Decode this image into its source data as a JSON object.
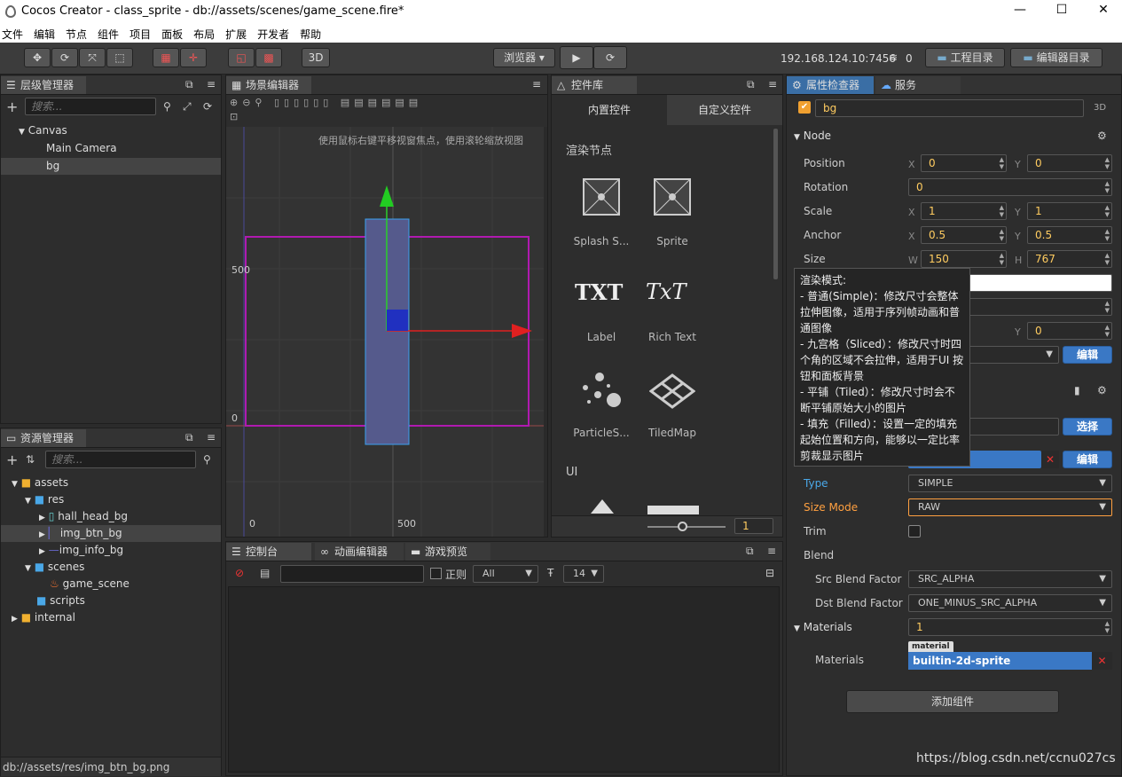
{
  "window": {
    "title": "Cocos Creator - class_sprite - db://assets/scenes/game_scene.fire*",
    "minimize": "—",
    "maximize": "☐",
    "close": "✕"
  },
  "menu": [
    "文件",
    "编辑",
    "节点",
    "组件",
    "项目",
    "面板",
    "布局",
    "扩展",
    "开发者",
    "帮助"
  ],
  "toolbar": {
    "mode_3d": "3D",
    "browser": "浏览器 ▾",
    "ip": "192.168.124.10:7456",
    "count": "0",
    "project_dir": "工程目录",
    "editor_dir": "编辑器目录"
  },
  "hierarchy": {
    "tab": "层级管理器",
    "search_placeholder": "搜索...",
    "items": [
      "Canvas",
      "Main Camera",
      "bg"
    ]
  },
  "assets": {
    "tab": "资源管理器",
    "search_placeholder": "搜索...",
    "items": [
      "assets",
      "res",
      "hall_head_bg",
      "img_btn_bg",
      "img_info_bg",
      "scenes",
      "game_scene",
      "scripts",
      "internal"
    ],
    "status": "db://assets/res/img_btn_bg.png"
  },
  "scene": {
    "tab": "场景编辑器",
    "hint": "使用鼠标右键平移视窗焦点，使用滚轮缩放视图",
    "y500": "500",
    "y0": "0",
    "x0": "0",
    "x500": "500"
  },
  "widgets": {
    "tab": "控件库",
    "builtin": "内置控件",
    "custom": "自定义控件",
    "section_render": "渲染节点",
    "section_ui": "UI",
    "items": [
      "Splash S...",
      "Sprite",
      "Label",
      "Rich Text",
      "ParticleS...",
      "TiledMap"
    ],
    "txt1": "TXT",
    "txt2": "TxT",
    "zoom": "1"
  },
  "console": {
    "tab_console": "控制台",
    "tab_anim": "动画编辑器",
    "tab_preview": "游戏预览",
    "regex": "正则",
    "filter": "All",
    "font_size": "14"
  },
  "inspector": {
    "tab": "属性检查器",
    "tab2": "服务",
    "node_name": "bg",
    "mode3d": "3D",
    "node_section": "Node",
    "position": {
      "label": "Position",
      "x": "0",
      "y": "0"
    },
    "rotation": {
      "label": "Rotation",
      "value": "0"
    },
    "scale": {
      "label": "Scale",
      "x": "1",
      "y": "1"
    },
    "anchor": {
      "label": "Anchor",
      "x": "0.5",
      "y": "0.5"
    },
    "size": {
      "label": "Size",
      "w": "150",
      "h": "767"
    },
    "hidden_y": "0",
    "edit": "编辑",
    "select": "选择",
    "type": {
      "label": "Type",
      "value": "SIMPLE"
    },
    "size_mode": {
      "label": "Size Mode",
      "value": "RAW"
    },
    "trim": "Trim",
    "blend": "Blend",
    "src_blend": {
      "label": "Src Blend Factor",
      "value": "SRC_ALPHA"
    },
    "dst_blend": {
      "label": "Dst Blend Factor",
      "value": "ONE_MINUS_SRC_ALPHA"
    },
    "materials_section": {
      "label": "Materials",
      "value": "1"
    },
    "materials": {
      "label": "Materials",
      "tag": "material",
      "value": "builtin-2d-sprite"
    },
    "add_component": "添加组件",
    "axis": {
      "x": "X",
      "y": "Y",
      "w": "W",
      "h": "H"
    }
  },
  "tooltip": [
    "渲染模式:",
    "- 普通(Simple)：修改尺寸会整体拉伸图像，适用于序列帧动画和普通图像",
    "- 九宫格（Sliced）：修改尺寸时四个角的区域不会拉伸，适用于UI 按钮和面板背景",
    "- 平铺（Tiled）：修改尺寸时会不断平铺原始大小的图片",
    "- 填充（Filled）：设置一定的填充起始位置和方向，能够以一定比率剪裁显示图片"
  ],
  "watermark": "https://blog.csdn.net/ccnu027cs",
  "colors": {
    "accent": "#3a78c5",
    "highlight": "#ffa040",
    "purple": "#b01ab0",
    "bg_panel": "#2d2d2d"
  }
}
